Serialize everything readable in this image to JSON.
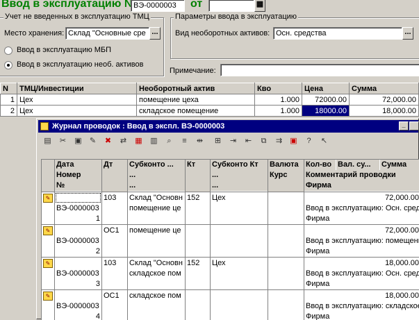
{
  "doc": {
    "title": "Ввод в эксплуатацию №",
    "number": "ВЭ-0000003",
    "date_label": "от",
    "date_value": ""
  },
  "group_left": {
    "title": "Учет не введенных в эксплуатацию ТМЦ",
    "storage_label": "Место хранения:",
    "storage_value": "Склад \"Основные сре",
    "radio1": "Ввод в эксплуатацию МБП",
    "radio2": "Ввод в эксплуатацию необ. активов"
  },
  "group_right": {
    "title": "Параметры ввода в эксплуатацию",
    "asset_label": "Вид необоротных активов:",
    "asset_value": "Осн. средства",
    "note_label": "Примечание:",
    "note_value": ""
  },
  "table": {
    "headers": [
      "N",
      "ТМЦ/Инвестиции",
      "Необоротный актив",
      "Кво",
      "Цена",
      "Сумма"
    ],
    "rows": [
      [
        "1",
        "Цех",
        "помещение цеха",
        "1.000",
        "72000.00",
        "72,000.00"
      ],
      [
        "2",
        "Цех",
        "складское помещение",
        "1.000",
        "18000.00",
        "18,000.00"
      ]
    ]
  },
  "journal": {
    "title": "Журнал проводок : Ввод в экспл. ВЭ-0000003",
    "headers": {
      "date": "Дата",
      "number": "Номер",
      "n": "№",
      "dt": "Дт",
      "sub_dt": "Субконто ...",
      "sub_dt2": "...",
      "sub_dt3": "...",
      "kt": "Кт",
      "sub_kt": "Субконто Кт",
      "sub_kt2": "...",
      "sub_kt3": "...",
      "currency": "Валюта",
      "rate": "Курс",
      "qty": "Кол-во",
      "cur_sum": "Вал. су...",
      "sum": "Сумма",
      "comment": "Комментарий проводки",
      "firm": "Фирма"
    },
    "entries": [
      {
        "doc": "ВЭ-0000003",
        "n": "1",
        "dt": "103",
        "sub1": "Склад \"Основн",
        "sub2": "помещение це",
        "kt": "152",
        "subkt": "Цех",
        "sum": "72,000.00",
        "comment": "Ввод в эксплуатацию: Осн. средст",
        "firm": "Фирма"
      },
      {
        "doc": "ВЭ-0000003",
        "n": "2",
        "dt": "ОС1",
        "sub1": "помещение це",
        "sub2": "",
        "kt": "",
        "subkt": "",
        "sum": "72,000.00",
        "comment": "Ввод в эксплуатацию: помещени",
        "firm": "Фирма"
      },
      {
        "doc": "ВЭ-0000003",
        "n": "3",
        "dt": "103",
        "sub1": "Склад \"Основн",
        "sub2": "складское пом",
        "kt": "152",
        "subkt": "Цех",
        "sum": "18,000.00",
        "comment": "Ввод в эксплуатацию: Осн. средст",
        "firm": "Фирма"
      },
      {
        "doc": "ВЭ-0000003",
        "n": "4",
        "dt": "ОС1",
        "sub1": "складское пом",
        "sub2": "",
        "kt": "",
        "subkt": "",
        "sum": "18,000.00",
        "comment": "Ввод в эксплуатацию: складское",
        "firm": "Фирма"
      }
    ]
  },
  "colors": {
    "title_green": "#008000",
    "title_bar": "#000080",
    "selection": "#000080"
  }
}
